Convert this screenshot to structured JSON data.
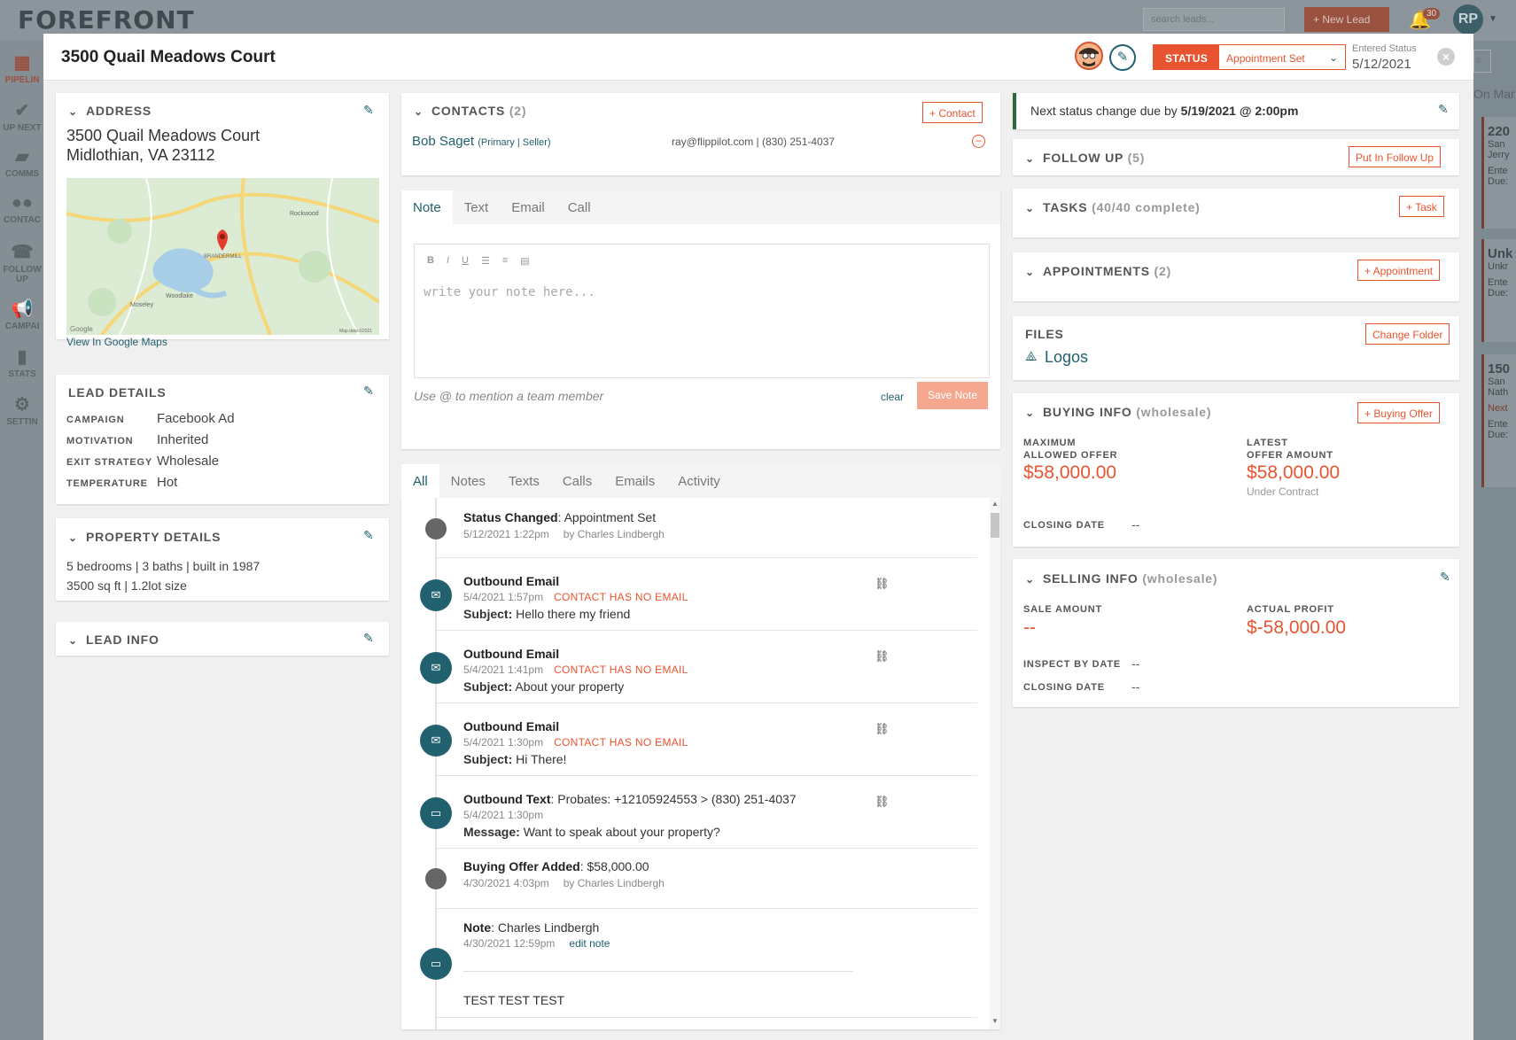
{
  "background": {
    "logo": "FOREFRONT",
    "search_placeholder": "search leads...",
    "new_lead_label": "+  New Lead",
    "notification_count": "30",
    "user_initials": "RP",
    "nav": [
      {
        "label": "PIPELIN",
        "icon": "pipeline-icon"
      },
      {
        "label": "UP NEXT",
        "icon": "up-next-icon"
      },
      {
        "label": "COMMS",
        "icon": "comms-icon"
      },
      {
        "label": "CONTAC",
        "icon": "contacts-icon"
      },
      {
        "label": "FOLLOW UP",
        "icon": "follow-up-icon"
      },
      {
        "label": "CAMPAI",
        "icon": "campaign-icon"
      },
      {
        "label": "STATS",
        "icon": "stats-icon"
      },
      {
        "label": "SETTIN",
        "icon": "settings-icon"
      }
    ],
    "right_heading": "On Mar",
    "right_cards": [
      {
        "line1": "220",
        "line2": "San",
        "line3": "Jerry",
        "line4": "Ente",
        "line5": "Due:"
      },
      {
        "line1": "Unk",
        "line2": "Unkr",
        "line3": "",
        "line4": "Ente",
        "line5": "Due:"
      },
      {
        "line1": "150",
        "line2": "San",
        "line3": "Nath",
        "line4": "Next",
        "line5": "Ente",
        "line6": "Due:"
      }
    ]
  },
  "modal": {
    "title": "3500 Quail Meadows Court",
    "status_label": "STATUS",
    "status_value": "Appointment Set",
    "entered_status_label": "Entered Status",
    "entered_status_date": "5/12/2021"
  },
  "address": {
    "title": "ADDRESS",
    "line1": "3500 Quail Meadows Court",
    "line2": "Midlothian, VA 23112",
    "map_link": "View In Google Maps",
    "map_labels": [
      "Rockwood",
      "BRANDERMILL",
      "Woodlake",
      "Moseley",
      "Google",
      "Map data ©2021"
    ]
  },
  "lead_details": {
    "title": "LEAD DETAILS",
    "rows": [
      {
        "label": "CAMPAIGN",
        "value": "Facebook Ad"
      },
      {
        "label": "MOTIVATION",
        "value": "Inherited"
      },
      {
        "label": "EXIT STRATEGY",
        "value": "Wholesale"
      },
      {
        "label": "TEMPERATURE",
        "value": "Hot"
      }
    ]
  },
  "property_details": {
    "title": "PROPERTY DETAILS",
    "line1": "5 bedrooms | 3 baths | built in 1987",
    "line2": "3500 sq ft | 1.2lot size"
  },
  "lead_info": {
    "title": "LEAD INFO"
  },
  "contacts": {
    "title": "CONTACTS",
    "count": "(2)",
    "add_label": "+   Contact",
    "name": "Bob Saget",
    "role": "(Primary | Seller)",
    "details": "ray@flippilot.com | (830) 251-4037"
  },
  "composer": {
    "tabs": [
      "Note",
      "Text",
      "Email",
      "Call"
    ],
    "toolbar": [
      "B",
      "I",
      "U",
      "☰",
      "≡",
      "▤"
    ],
    "placeholder": "write your note here...",
    "mention_hint": "Use @ to mention a team member",
    "clear_label": "clear",
    "save_label": "Save Note"
  },
  "feed": {
    "tabs": [
      "All",
      "Notes",
      "Texts",
      "Calls",
      "Emails",
      "Activity"
    ],
    "items": [
      {
        "kind": "dot",
        "title_bold": "Status Changed",
        "title_rest": ": Appointment Set",
        "date": "5/12/2021 1:22pm",
        "by": "by Charles Lindbergh"
      },
      {
        "kind": "email",
        "title_bold": "Outbound Email",
        "date": "5/4/2021 1:57pm",
        "warning": "CONTACT HAS NO EMAIL",
        "sub_bold": "Subject:",
        "sub_rest": " Hello there my friend"
      },
      {
        "kind": "email",
        "title_bold": "Outbound Email",
        "date": "5/4/2021 1:41pm",
        "warning": "CONTACT HAS NO EMAIL",
        "sub_bold": "Subject:",
        "sub_rest": " About your property"
      },
      {
        "kind": "email",
        "title_bold": "Outbound Email",
        "date": "5/4/2021 1:30pm",
        "warning": "CONTACT HAS NO EMAIL",
        "sub_bold": "Subject:",
        "sub_rest": " Hi There!"
      },
      {
        "kind": "text",
        "title_bold": "Outbound Text",
        "title_rest": ": Probates: +12105924553 > (830) 251-4037",
        "date": "5/4/2021 1:30pm",
        "sub_bold": "Message:",
        "sub_rest": " Want to speak about your property?"
      },
      {
        "kind": "dot",
        "title_bold": "Buying Offer Added",
        "title_rest": ": $58,000.00",
        "date": "4/30/2021 4:03pm",
        "by": "by Charles Lindbergh"
      },
      {
        "kind": "note",
        "title_bold": "Note",
        "title_rest": ": Charles Lindbergh",
        "date": "4/30/2021 12:59pm",
        "edit": "edit note",
        "body": "TEST TEST TEST"
      }
    ]
  },
  "right": {
    "next_status_prefix": "Next status change due by ",
    "next_status_due": "5/19/2021 @ 2:00pm",
    "follow_up": {
      "title": "FOLLOW UP",
      "count": "(5)",
      "button": "Put In Follow Up"
    },
    "tasks": {
      "title": "TASKS",
      "count": "(40/40 complete)",
      "button": "+   Task"
    },
    "appointments": {
      "title": "APPOINTMENTS",
      "count": "(2)",
      "button": "+   Appointment"
    },
    "files": {
      "title": "FILES",
      "button": "Change Folder",
      "folder": "Logos"
    },
    "buying": {
      "title": "BUYING INFO",
      "suffix": "(wholesale)",
      "button": "+   Buying Offer",
      "mao_label_1": "MAXIMUM",
      "mao_label_2": "ALLOWED OFFER",
      "mao_value": "$58,000.00",
      "latest_label_1": "LATEST",
      "latest_label_2": "OFFER AMOUNT",
      "latest_value": "$58,000.00",
      "latest_note": "Under Contract",
      "closing_label": "CLOSING DATE",
      "closing_value": "--"
    },
    "selling": {
      "title": "SELLING INFO",
      "suffix": "(wholesale)",
      "sale_label": "SALE AMOUNT",
      "sale_value": "--",
      "profit_label": "ACTUAL PROFIT",
      "profit_value": "$-58,000.00",
      "inspect_label": "INSPECT BY DATE",
      "inspect_value": "--",
      "closing_label": "CLOSING DATE",
      "closing_value": "--"
    }
  },
  "colors": {
    "accent": "#e8542f",
    "teal": "#21606e",
    "green_bar": "#2f6b3a"
  }
}
